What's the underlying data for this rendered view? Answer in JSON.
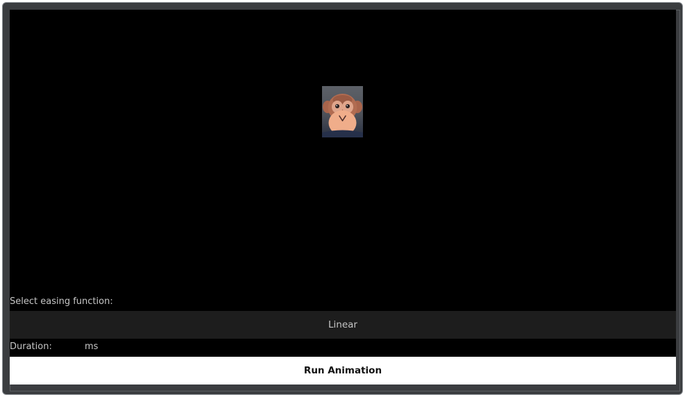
{
  "controls": {
    "easing_label": "Select easing function:",
    "easing_selected": "Linear",
    "duration_label": "Duration:",
    "duration_value": "",
    "duration_unit": "ms",
    "run_label": "Run Animation"
  },
  "sprite": {
    "icon": "monkey-face-icon"
  },
  "colors": {
    "window_frame": "#3b3d40",
    "stage_background": "#000000",
    "select_background": "#1d1d1d",
    "button_background": "#ffffff",
    "button_text": "#111111",
    "label_text": "#c6c6c6"
  }
}
